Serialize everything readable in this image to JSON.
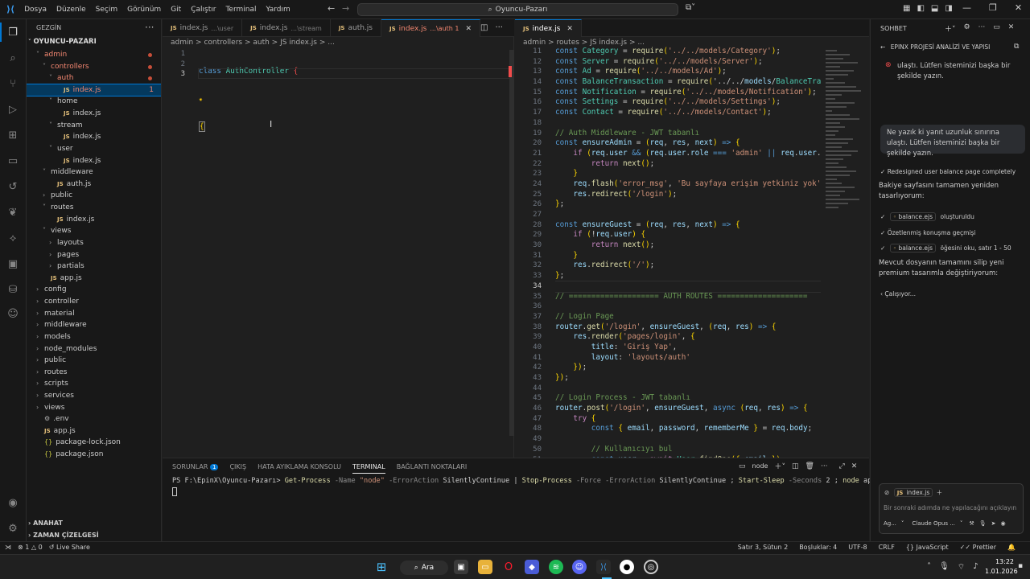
{
  "menu": [
    "Dosya",
    "Düzenle",
    "Seçim",
    "Görünüm",
    "Git",
    "Çalıştır",
    "Terminal",
    "Yardım"
  ],
  "command_center": "Oyuncu-Pazarı",
  "sidebar": {
    "header": "GEZGİN",
    "root": "OYUNCU-PAZARI",
    "items": [
      {
        "label": "admin",
        "indent": 1,
        "type": "folder-open",
        "dot": true
      },
      {
        "label": "controllers",
        "indent": 2,
        "type": "folder-open",
        "dot": true
      },
      {
        "label": "auth",
        "indent": 3,
        "type": "folder-open",
        "dot": true
      },
      {
        "label": "index.js",
        "indent": 4,
        "type": "js",
        "badge": "1",
        "selected": true
      },
      {
        "label": "home",
        "indent": 3,
        "type": "folder-open"
      },
      {
        "label": "index.js",
        "indent": 4,
        "type": "js"
      },
      {
        "label": "stream",
        "indent": 3,
        "type": "folder-open"
      },
      {
        "label": "index.js",
        "indent": 4,
        "type": "js"
      },
      {
        "label": "user",
        "indent": 3,
        "type": "folder-open"
      },
      {
        "label": "index.js",
        "indent": 4,
        "type": "js"
      },
      {
        "label": "middleware",
        "indent": 2,
        "type": "folder-open"
      },
      {
        "label": "auth.js",
        "indent": 3,
        "type": "js"
      },
      {
        "label": "public",
        "indent": 2,
        "type": "folder"
      },
      {
        "label": "routes",
        "indent": 2,
        "type": "folder-open"
      },
      {
        "label": "index.js",
        "indent": 3,
        "type": "js"
      },
      {
        "label": "views",
        "indent": 2,
        "type": "folder-open"
      },
      {
        "label": "layouts",
        "indent": 3,
        "type": "folder"
      },
      {
        "label": "pages",
        "indent": 3,
        "type": "folder"
      },
      {
        "label": "partials",
        "indent": 3,
        "type": "folder"
      },
      {
        "label": "app.js",
        "indent": 2,
        "type": "js"
      },
      {
        "label": "config",
        "indent": 1,
        "type": "folder"
      },
      {
        "label": "controller",
        "indent": 1,
        "type": "folder"
      },
      {
        "label": "material",
        "indent": 1,
        "type": "folder"
      },
      {
        "label": "middleware",
        "indent": 1,
        "type": "folder"
      },
      {
        "label": "models",
        "indent": 1,
        "type": "folder"
      },
      {
        "label": "node_modules",
        "indent": 1,
        "type": "folder"
      },
      {
        "label": "public",
        "indent": 1,
        "type": "folder"
      },
      {
        "label": "routes",
        "indent": 1,
        "type": "folder"
      },
      {
        "label": "scripts",
        "indent": 1,
        "type": "folder"
      },
      {
        "label": "services",
        "indent": 1,
        "type": "folder"
      },
      {
        "label": "views",
        "indent": 1,
        "type": "folder"
      },
      {
        "label": ".env",
        "indent": 1,
        "type": "env"
      },
      {
        "label": "app.js",
        "indent": 1,
        "type": "js"
      },
      {
        "label": "package-lock.json",
        "indent": 1,
        "type": "json"
      },
      {
        "label": "package.json",
        "indent": 1,
        "type": "json"
      }
    ],
    "outline": "ANAHAT",
    "timeline": "ZAMAN ÇİZELGESİ"
  },
  "editor_left": {
    "tabs": [
      {
        "name": "index.js",
        "desc": "...\\user"
      },
      {
        "name": "index.js",
        "desc": "...\\stream"
      },
      {
        "name": "auth.js",
        "desc": ""
      },
      {
        "name": "index.js",
        "desc": "...\\auth 1",
        "active": true
      }
    ],
    "breadcrumb": "admin > controllers > auth > JS index.js > ...",
    "line_numbers": [
      "1",
      "2",
      "3"
    ],
    "code": {
      "line1_kw": "class",
      "line1_name": "AuthController",
      "line1_brace": "{"
    }
  },
  "editor_right": {
    "tabs": [
      {
        "name": "index.js",
        "active": true
      }
    ],
    "breadcrumb": "admin > routes > JS index.js > ...",
    "line_numbers": [
      "11",
      "12",
      "13",
      "14",
      "15",
      "16",
      "17",
      "18",
      "19",
      "20",
      "21",
      "22",
      "23",
      "24",
      "25",
      "26",
      "27",
      "28",
      "29",
      "30",
      "31",
      "32",
      "33",
      "34",
      "35",
      "36",
      "37",
      "38",
      "39",
      "40",
      "41",
      "42",
      "43",
      "44",
      "45",
      "46",
      "47",
      "48",
      "49",
      "50",
      "51"
    ],
    "lines": [
      "const Category = require('../../models/Category');",
      "const Server = require('../../models/Server');",
      "const Ad = require('../../models/Ad');",
      "const BalanceTransaction = require('../../models/BalanceTransact",
      "const Notification = require('../../models/Notification');",
      "const Settings = require('../../models/Settings');",
      "const Contact = require('../../models/Contact');",
      "",
      "// Auth Middleware - JWT tabanlı",
      "const ensureAdmin = (req, res, next) => {",
      "    if (req.user && (req.user.role === 'admin' || req.user.role",
      "        return next();",
      "    }",
      "    req.flash('error_msg', 'Bu sayfaya erişim yetkiniz yok');",
      "    res.redirect('/login');",
      "};",
      "",
      "const ensureGuest = (req, res, next) => {",
      "    if (!req.user) {",
      "        return next();",
      "    }",
      "    res.redirect('/');",
      "};",
      "",
      "// ==================== AUTH ROUTES ====================",
      "",
      "// Login Page",
      "router.get('/login', ensureGuest, (req, res) => {",
      "    res.render('pages/login', {",
      "        title: 'Giriş Yap',",
      "        layout: 'layouts/auth'",
      "    });",
      "});",
      "",
      "// Login Process - JWT tabanlı",
      "router.post('/login', ensureGuest, async (req, res) => {",
      "    try {",
      "        const { email, password, rememberMe } = req.body;",
      "",
      "        // Kullanıcıyı bul",
      "        const user = await User.findOne({ email });"
    ]
  },
  "panel": {
    "tabs": [
      "SORUNLAR",
      "ÇIKIŞ",
      "HATA AYIKLAMA KONSOLU",
      "TERMINAL",
      "BAĞLANTI NOKTALARI"
    ],
    "problems_count": "1",
    "terminal_name": "node",
    "prompt": "PS F:\\EpinX\\Oyuncu-Pazarı>",
    "command_parts": [
      {
        "t": "Get-Process",
        "c": "fn"
      },
      {
        "t": " -Name ",
        "c": "dim"
      },
      {
        "t": "\"node\"",
        "c": "str"
      },
      {
        "t": " -ErrorAction ",
        "c": "dim"
      },
      {
        "t": "SilentlyContinue",
        "c": "plain"
      },
      {
        "t": " | ",
        "c": "plain"
      },
      {
        "t": "Stop-Process",
        "c": "fn"
      },
      {
        "t": " -Force -ErrorAction ",
        "c": "dim"
      },
      {
        "t": "SilentlyContinue",
        "c": "plain"
      },
      {
        "t": " ; ",
        "c": "plain"
      },
      {
        "t": "Start-Sleep",
        "c": "fn"
      },
      {
        "t": " -Seconds ",
        "c": "dim"
      },
      {
        "t": "2",
        "c": "plain"
      },
      {
        "t": " ; ",
        "c": "plain"
      },
      {
        "t": "node",
        "c": "fn"
      },
      {
        "t": " app.js",
        "c": "plain"
      }
    ]
  },
  "chat": {
    "header": "SOHBET",
    "session_title": "EPINX PROJESİ ANALİZİ VE YAPISI",
    "error_text": "ulaştı. Lütfen isteminizi başka bir şekilde yazın.",
    "user_message": "Ne yazık ki yanıt uzunluk sınırına ulaştı. Lütfen isteminizi başka bir şekilde yazın.",
    "step1": "Redesigned user balance page completely",
    "paragraph1": "Bakiye sayfasını tamamen yeniden tasarlıyorum:",
    "file1": "balance.ejs",
    "file1_suffix": "oluşturuldu",
    "step2": "Özetlenmiş konuşma geçmişi",
    "file2": "balance.ejs",
    "file2_suffix": "öğesini oku, satır 1 - 50",
    "paragraph2": "Mevcut dosyanın tamamını silip yeni premium tasarımla değiştiriyorum:",
    "working": "Çalışıyor...",
    "context_file": "index.js",
    "input_placeholder": "Bir sonraki adımda ne yapılacağını açıklayın",
    "agent_label": "Ag...",
    "model_label": "Claude Opus ..."
  },
  "statusbar": {
    "errors": "1",
    "warnings": "0",
    "live_share": "Live Share",
    "position": "Satır 3, Sütun 2",
    "spaces": "Boşluklar: 4",
    "encoding": "UTF-8",
    "eol": "CRLF",
    "language": "JavaScript",
    "prettier": "Prettier"
  },
  "taskbar": {
    "search": "Ara",
    "time": "13:22",
    "date": "1.01.2026"
  },
  "colors": {
    "accent": "#0078d4",
    "background": "#1f1f1f",
    "sidebar": "#181818"
  }
}
